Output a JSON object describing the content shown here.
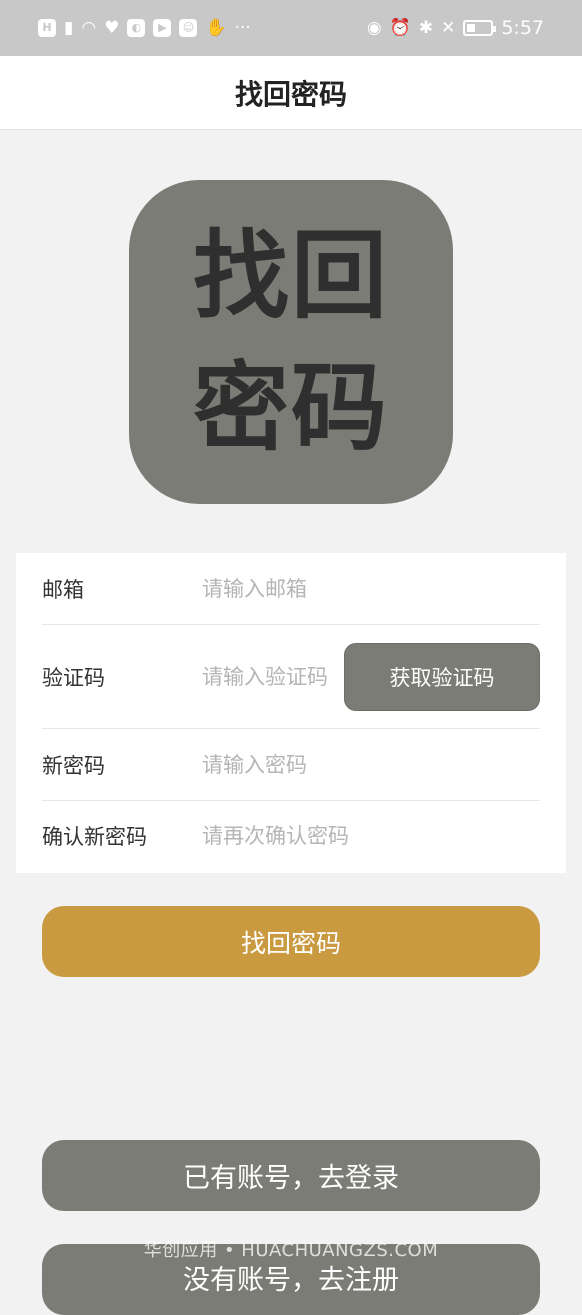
{
  "status_bar": {
    "left_icons": [
      "hd-icon",
      "signal-4g-icon",
      "wifi-icon",
      "heart-app-icon",
      "colorful-app-icon",
      "play-app-icon",
      "game-app-icon",
      "hand-app-icon"
    ],
    "more": "···",
    "right_icons": [
      "eye-icon",
      "alarm-icon",
      "bluetooth-icon",
      "mute-icon",
      "battery-icon"
    ],
    "time": "5:57"
  },
  "nav": {
    "title": "找回密码"
  },
  "logo": {
    "line1": "找回",
    "line2": "密码"
  },
  "form": {
    "email": {
      "label": "邮箱",
      "placeholder": "请输入邮箱"
    },
    "code": {
      "label": "验证码",
      "placeholder": "请输入验证码",
      "button": "获取验证码"
    },
    "new_password": {
      "label": "新密码",
      "placeholder": "请输入密码"
    },
    "confirm_password": {
      "label": "确认新密码",
      "placeholder": "请再次确认密码"
    }
  },
  "buttons": {
    "submit": "找回密码",
    "login": "已有账号，去登录",
    "register": "没有账号，去注册"
  },
  "watermark": "华创应用 • HUACHUANGZS.COM",
  "colors": {
    "status_bar": "#c8c8c8",
    "accent_gold": "#c99a40",
    "gray_button": "#7b7c76",
    "background": "#f2f2f2"
  }
}
